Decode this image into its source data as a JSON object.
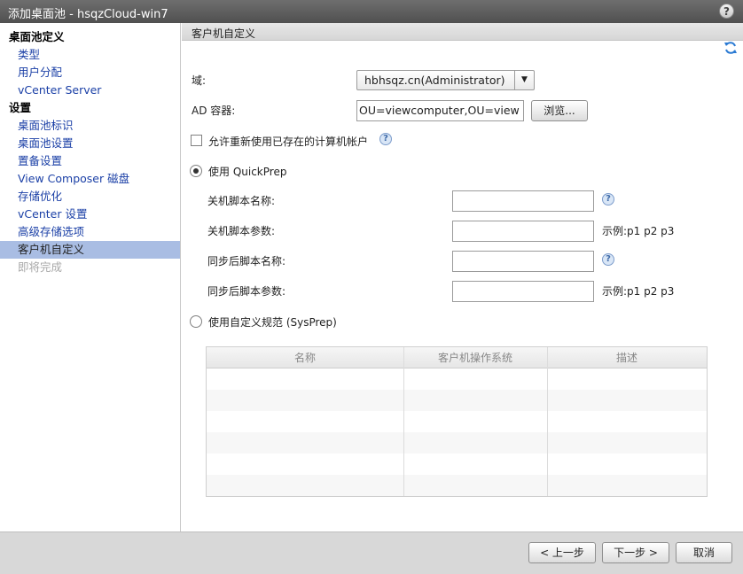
{
  "window": {
    "title": "添加桌面池 - hsqzCloud-win7",
    "help_label": "?"
  },
  "sidebar": {
    "sections": [
      {
        "title": "桌面池定义",
        "items": [
          "类型",
          "用户分配",
          "vCenter Server"
        ]
      },
      {
        "title": "设置",
        "items": [
          "桌面池标识",
          "桌面池设置",
          "置备设置",
          "View Composer 磁盘",
          "存储优化",
          "vCenter 设置",
          "高级存储选项",
          "客户机自定义",
          "即将完成"
        ]
      }
    ],
    "active_item": "客户机自定义",
    "disabled_item": "即将完成"
  },
  "panel": {
    "header": "客户机自定义",
    "domain_label": "域:",
    "domain_value": "hbhsqz.cn(Administrator)",
    "ad_label": "AD 容器:",
    "ad_value": "OU=viewcomputer,OU=view",
    "browse_label": "浏览...",
    "reuse_label": "允许重新使用已存在的计算机帐户",
    "quickprep_label": "使用 QuickPrep",
    "shutdown_script_name_label": "关机脚本名称:",
    "shutdown_script_params_label": "关机脚本参数:",
    "shutdown_example": "示例:p1 p2 p3",
    "postsync_script_name_label": "同步后脚本名称:",
    "postsync_script_params_label": "同步后脚本参数:",
    "postsync_example": "示例:p1 p2 p3",
    "sysprep_label": "使用自定义规范 (SysPrep)",
    "table_columns": [
      "名称",
      "客户机操作系统",
      "描述"
    ]
  },
  "footer": {
    "back_label": "< 上一步",
    "next_label": "下一步 >",
    "cancel_label": "取消"
  },
  "state": {
    "quickprep_selected": true,
    "sysprep_selected": false,
    "reuse_checked": false
  }
}
